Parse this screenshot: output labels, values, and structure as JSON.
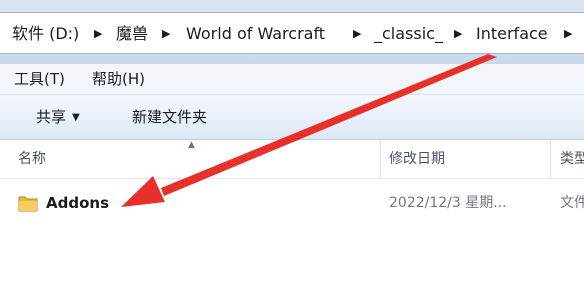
{
  "breadcrumb": {
    "items": [
      "软件 (D:)",
      "魔兽",
      "World of Warcraft",
      "_classic_",
      "Interface"
    ],
    "separator": "▶"
  },
  "menu": {
    "items": [
      "工具(T)",
      "帮助(H)"
    ]
  },
  "toolbar": {
    "share_label": "共享",
    "new_folder_label": "新建文件夹"
  },
  "columns": {
    "name": "名称",
    "modified": "修改日期",
    "type": "类型"
  },
  "files": [
    {
      "name": "Addons",
      "modified": "2022/12/3 星期...",
      "type": "文件",
      "icon": "folder-icon"
    }
  ],
  "colors": {
    "annotation_arrow": "#e8302a",
    "folder": "#e9b93a"
  }
}
